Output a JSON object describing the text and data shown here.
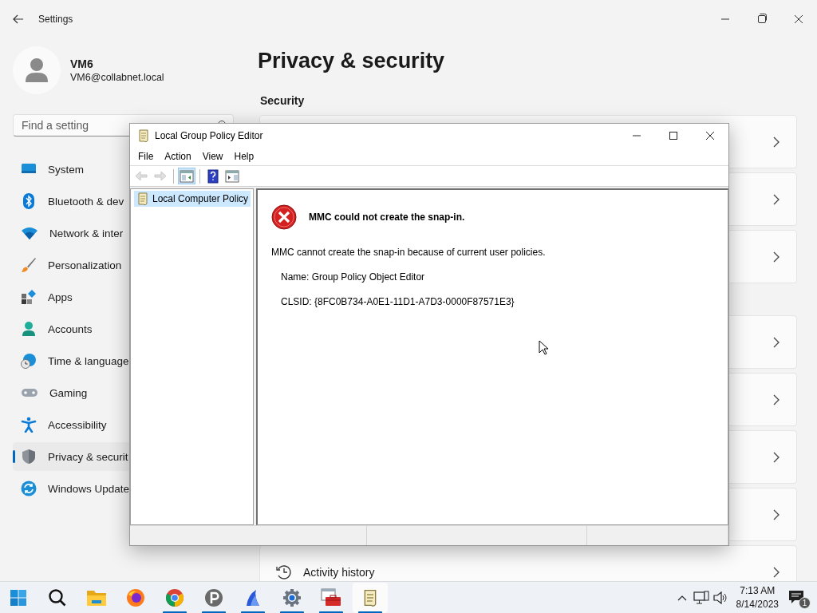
{
  "settings": {
    "title": "Settings",
    "user": {
      "name": "VM6",
      "email": "VM6@collabnet.local"
    },
    "search": {
      "placeholder": "Find a setting"
    },
    "nav": [
      {
        "label": "System",
        "selected": false
      },
      {
        "label": "Bluetooth & dev",
        "selected": false
      },
      {
        "label": "Network & inter",
        "selected": false
      },
      {
        "label": "Personalization",
        "selected": false
      },
      {
        "label": "Apps",
        "selected": false
      },
      {
        "label": "Accounts",
        "selected": false
      },
      {
        "label": "Time & language",
        "selected": false
      },
      {
        "label": "Gaming",
        "selected": false
      },
      {
        "label": "Accessibility",
        "selected": false
      },
      {
        "label": "Privacy & securit",
        "selected": true
      },
      {
        "label": "Windows Update",
        "selected": false
      }
    ],
    "page_title": "Privacy & security",
    "section": "Security",
    "card_groups": [
      [
        {
          "kind": "plain"
        },
        {
          "kind": "plain"
        },
        {
          "kind": "plain"
        }
      ],
      [
        {
          "kind": "plain"
        },
        {
          "kind": "plain"
        },
        {
          "kind": "plain"
        },
        {
          "kind": "plain"
        },
        {
          "kind": "labeled",
          "label": "Activity history"
        }
      ]
    ]
  },
  "mmc": {
    "title": "Local Group Policy Editor",
    "menu": [
      "File",
      "Action",
      "View",
      "Help"
    ],
    "toolbar": [
      {
        "disabled": true,
        "pressed": false
      },
      {
        "disabled": true,
        "pressed": false
      },
      {
        "disabled": false,
        "pressed": true
      },
      {
        "disabled": false,
        "pressed": false
      },
      {
        "disabled": false,
        "pressed": false
      }
    ],
    "tree": [
      {
        "label": "Local Computer Policy",
        "selected": true
      }
    ],
    "error": {
      "title": "MMC could not create the snap-in.",
      "message": "MMC cannot create the snap-in because of current user policies.",
      "details": [
        "Name: Group Policy Object Editor",
        "CLSID: {8FC0B734-A0E1-11D1-A7D3-0000F87571E3}"
      ]
    }
  },
  "taskbar": {
    "apps": [
      {
        "running": false,
        "selected": false
      },
      {
        "running": false,
        "selected": false
      },
      {
        "running": false,
        "selected": false
      },
      {
        "running": false,
        "selected": false
      },
      {
        "running": true,
        "selected": false
      },
      {
        "running": true,
        "selected": false
      },
      {
        "running": true,
        "selected": false
      },
      {
        "running": true,
        "selected": false
      },
      {
        "running": true,
        "selected": false
      },
      {
        "running": true,
        "selected": true
      }
    ],
    "tray": {
      "time": "7:13 AM",
      "date": "8/14/2023",
      "notification_count": "1"
    }
  }
}
